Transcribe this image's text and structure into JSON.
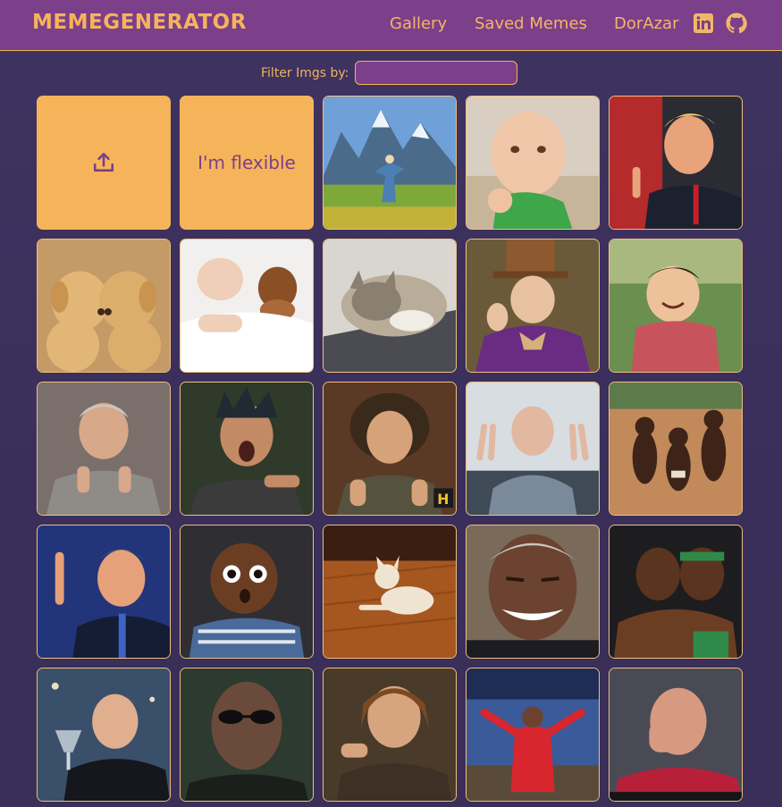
{
  "header": {
    "logo": "MEMEGENERATOR",
    "nav": [
      {
        "label": "Gallery"
      },
      {
        "label": "Saved Memes"
      },
      {
        "label": "DorAzar"
      }
    ],
    "icons": [
      "linkedin-icon",
      "github-icon"
    ]
  },
  "filter": {
    "label": "Filter Imgs by:",
    "value": "",
    "placeholder": ""
  },
  "gallery": {
    "upload_icon": "upload-icon",
    "flex_label": "I'm flexible",
    "images": [
      {
        "subject": "woman twirling in mountain meadow"
      },
      {
        "subject": "baby with clenched fist on beach"
      },
      {
        "subject": "man grimacing at podium"
      },
      {
        "subject": "two puppies kissing"
      },
      {
        "subject": "baby and puppy under blanket"
      },
      {
        "subject": "cat sleeping on laptop"
      },
      {
        "subject": "man in top hat and purple coat"
      },
      {
        "subject": "laughing toddler in plaid shirt"
      },
      {
        "subject": "man pointing with both hands"
      },
      {
        "subject": "man shouting in surprise"
      },
      {
        "subject": "man with wild hair gesturing"
      },
      {
        "subject": "bald man making peace signs"
      },
      {
        "subject": "children dancing on dirt ground"
      },
      {
        "subject": "man pointing upward"
      },
      {
        "subject": "wide-eyed baby in striped shirt"
      },
      {
        "subject": "puppy stretching on wood floor"
      },
      {
        "subject": "man laughing with eyes closed"
      },
      {
        "subject": "two athletes embracing"
      },
      {
        "subject": "man raising a glass"
      },
      {
        "subject": "bald man with dark glasses"
      },
      {
        "subject": "man with hand gesture"
      },
      {
        "subject": "woman in red with open arms"
      },
      {
        "subject": "bald man facepalming"
      }
    ]
  },
  "colors": {
    "accent": "#f6b45a",
    "header_bg": "#7c3f8a",
    "page_bg": "#3d3160"
  }
}
